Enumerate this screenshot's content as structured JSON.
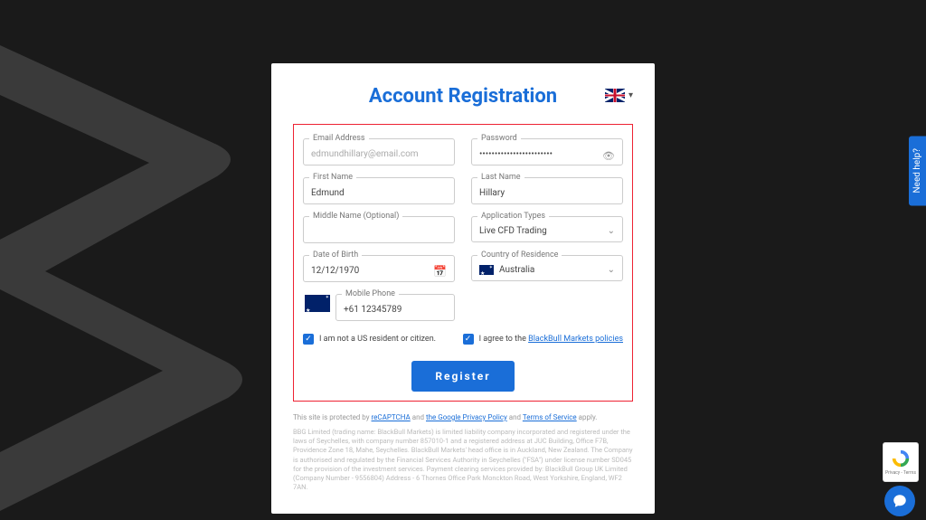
{
  "title": "Account Registration",
  "language": {
    "flag": "uk"
  },
  "fields": {
    "email": {
      "label": "Email Address",
      "value": "",
      "placeholder": "edmundhillary@email.com"
    },
    "password": {
      "label": "Password",
      "value": "••••••••••••••••••••••••"
    },
    "first_name": {
      "label": "First Name",
      "value": "Edmund"
    },
    "last_name": {
      "label": "Last Name",
      "value": "Hillary"
    },
    "middle_name": {
      "label": "Middle Name (Optional)",
      "value": ""
    },
    "app_type": {
      "label": "Application Types",
      "value": "Live CFD Trading"
    },
    "dob": {
      "label": "Date of Birth",
      "value": "12/12/1970"
    },
    "country": {
      "label": "Country of Residence",
      "value": "Australia"
    },
    "phone": {
      "label": "Mobile Phone",
      "prefix": "+61",
      "value": "12345789"
    }
  },
  "checkboxes": {
    "not_us": {
      "label": "I am not a US resident or citizen.",
      "checked": true
    },
    "agree": {
      "prefix": "I agree to the ",
      "link": "BlackBull Markets policies",
      "checked": true
    }
  },
  "register_label": "Register",
  "footer": {
    "line": "This site is protected by ",
    "link1": "reCAPTCHA",
    "and1": " and ",
    "link2": "the Google Privacy Policy",
    "and2": " and ",
    "link3": "Terms of Service",
    "apply": " apply."
  },
  "disclaimer": "BBG Limited (trading name: BlackBull Markets) is limited liability company incorporated and registered under the laws of Seychelles, with company number 857010-1 and a registered address at JUC Building, Office F7B, Providence Zone 18, Mahe, Seychelles. BlackBull Markets' head office is in Auckland, New Zealand. The Company is authorised and regulated by the Financial Services Authority in Seychelles (\"FSA\") under license number SD045 for the provision of the investment services. Payment clearing services provided by: BlackBull Group UK Limited (Company Number - 9556804) Address - 6 Thornes Office Park Monckton Road, West Yorkshire, England, WF2 7AN.",
  "help_tab": "Need help?",
  "recaptcha_footer": "Privacy - Terms"
}
